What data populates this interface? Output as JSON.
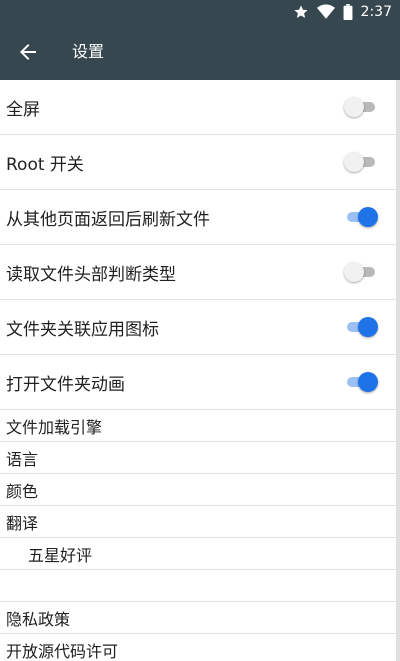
{
  "colors": {
    "app_bar": "#37474f",
    "accent": "#1e73e8",
    "switch_off_track": "#b9b9b9",
    "switch_on_track": "#9bc1f2"
  },
  "status_bar": {
    "time": "2:37",
    "icons": [
      "star-icon",
      "wifi-icon",
      "battery-icon"
    ]
  },
  "app_bar": {
    "back_icon": "arrow-left-icon",
    "title": "设置"
  },
  "settings": {
    "toggles": [
      {
        "label": "全屏",
        "on": false
      },
      {
        "label": "Root 开关",
        "on": false
      },
      {
        "label": "从其他页面返回后刷新文件",
        "on": true
      },
      {
        "label": "读取文件头部判断类型",
        "on": false
      },
      {
        "label": "文件夹关联应用图标",
        "on": true
      },
      {
        "label": "打开文件夹动画",
        "on": true
      }
    ],
    "items": [
      {
        "label": "文件加载引擎"
      },
      {
        "label": "语言"
      },
      {
        "label": "颜色"
      },
      {
        "label": "翻译"
      },
      {
        "label": "五星好评"
      },
      {
        "label": ""
      },
      {
        "label": "隐私政策"
      },
      {
        "label": "开放源代码许可"
      }
    ]
  }
}
